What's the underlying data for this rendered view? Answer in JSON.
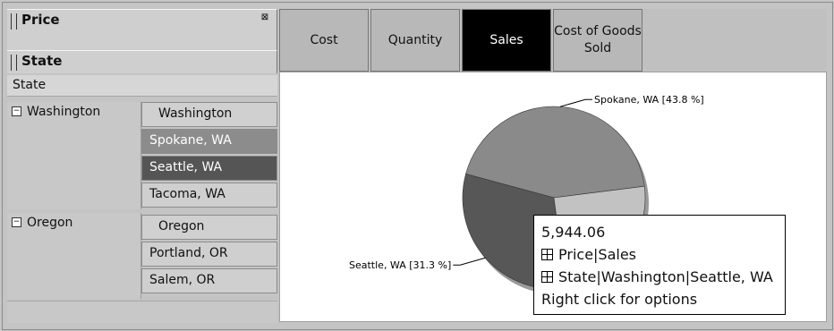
{
  "dimensions": {
    "price_label": "Price",
    "state_label": "State",
    "column_header": "State"
  },
  "tree": {
    "groups": [
      {
        "label": "Washington",
        "header": "Washington",
        "cities": [
          "Spokane, WA",
          "Seattle, WA",
          "Tacoma, WA"
        ]
      },
      {
        "label": "Oregon",
        "header": "Oregon",
        "cities": [
          "Portland, OR",
          "Salem, OR"
        ]
      }
    ],
    "expand_icon": "minus-box-icon"
  },
  "tabs": [
    {
      "label": "Cost",
      "active": false
    },
    {
      "label": "Quantity",
      "active": false
    },
    {
      "label": "Sales",
      "active": true
    },
    {
      "label": "Cost of Goods Sold",
      "active": false
    }
  ],
  "chart_data": {
    "type": "pie",
    "slices": [
      {
        "label": "Spokane, WA [43.8 %]",
        "name": "Spokane, WA",
        "value": 43.8,
        "color": "#8a8a8a"
      },
      {
        "label": "Seattle, WA [31.3 %]",
        "name": "Seattle, WA",
        "value": 31.3,
        "color": "#575757"
      },
      {
        "label": "",
        "name": "Tacoma, WA",
        "value": 24.9,
        "color": "#c2c2c2"
      }
    ]
  },
  "tooltip": {
    "value": "5,944.06",
    "line1": "Price|Sales",
    "line2": "State|Washington|Seattle, WA",
    "footer": "Right click for options"
  },
  "colors": {
    "active_tab": "#000000",
    "highlight_dark": "#555555",
    "highlight_mid": "#8c8c8c"
  }
}
